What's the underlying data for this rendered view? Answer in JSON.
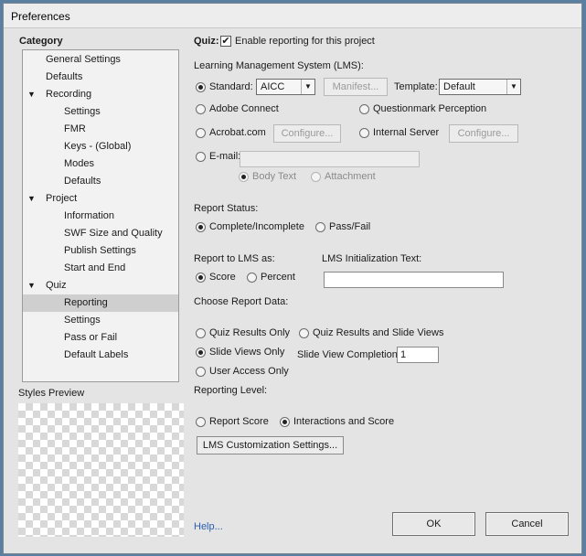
{
  "window": {
    "title": "Preferences"
  },
  "sidebar": {
    "category_label": "Category",
    "items": [
      {
        "label": "General Settings",
        "level": 1,
        "expander": ""
      },
      {
        "label": "Defaults",
        "level": 1,
        "expander": ""
      },
      {
        "label": "Recording",
        "level": 1,
        "expander": "▼"
      },
      {
        "label": "Settings",
        "level": 2,
        "expander": ""
      },
      {
        "label": "FMR",
        "level": 2,
        "expander": ""
      },
      {
        "label": "Keys - (Global)",
        "level": 2,
        "expander": ""
      },
      {
        "label": "Modes",
        "level": 2,
        "expander": ""
      },
      {
        "label": "Defaults",
        "level": 2,
        "expander": ""
      },
      {
        "label": "Project",
        "level": 1,
        "expander": "▼"
      },
      {
        "label": "Information",
        "level": 2,
        "expander": ""
      },
      {
        "label": "SWF Size and Quality",
        "level": 2,
        "expander": ""
      },
      {
        "label": "Publish Settings",
        "level": 2,
        "expander": ""
      },
      {
        "label": "Start and End",
        "level": 2,
        "expander": ""
      },
      {
        "label": "Quiz",
        "level": 1,
        "expander": "▼"
      },
      {
        "label": "Reporting",
        "level": 2,
        "expander": "",
        "selected": true
      },
      {
        "label": "Settings",
        "level": 2,
        "expander": ""
      },
      {
        "label": "Pass or Fail",
        "level": 2,
        "expander": ""
      },
      {
        "label": "Default Labels",
        "level": 2,
        "expander": ""
      }
    ],
    "styles_preview_label": "Styles Preview"
  },
  "main": {
    "quiz_label": "Quiz:",
    "enable_reporting": {
      "label": "Enable reporting for this project",
      "checked": true
    },
    "lms_label": "Learning Management System (LMS):",
    "standard": {
      "label": "Standard:",
      "value": "AICC",
      "checked": true
    },
    "manifest_button": "Manifest...",
    "template_label": "Template:",
    "template_value": "Default",
    "adobe_connect": "Adobe Connect",
    "questionmark": "Questionmark Perception",
    "acrobat": "Acrobat.com",
    "configure_button_1": "Configure...",
    "internal_server": "Internal Server",
    "configure_button_2": "Configure...",
    "email_label": "E-mail:",
    "email_value": "",
    "body_text": "Body Text",
    "attachment": "Attachment",
    "report_status_label": "Report Status:",
    "complete_incomplete": "Complete/Incomplete",
    "pass_fail": "Pass/Fail",
    "report_to_lms_label": "Report to LMS as:",
    "score": "Score",
    "percent": "Percent",
    "lms_init_text_label": "LMS Initialization Text:",
    "lms_init_text_value": "",
    "choose_report_data_label": "Choose Report Data:",
    "quiz_results_only": "Quiz Results Only",
    "quiz_results_slide_views": "Quiz Results and Slide Views",
    "slide_views_only": "Slide Views Only",
    "slide_view_completion_label": "Slide View Completion",
    "slide_view_completion_value": "1",
    "user_access_only": "User Access Only",
    "reporting_level_label": "Reporting Level:",
    "report_score": "Report Score",
    "interactions_score": "Interactions and Score",
    "lms_customization_button": "LMS Customization Settings..."
  },
  "footer": {
    "help_link": "Help...",
    "ok_button": "OK",
    "cancel_button": "Cancel"
  }
}
